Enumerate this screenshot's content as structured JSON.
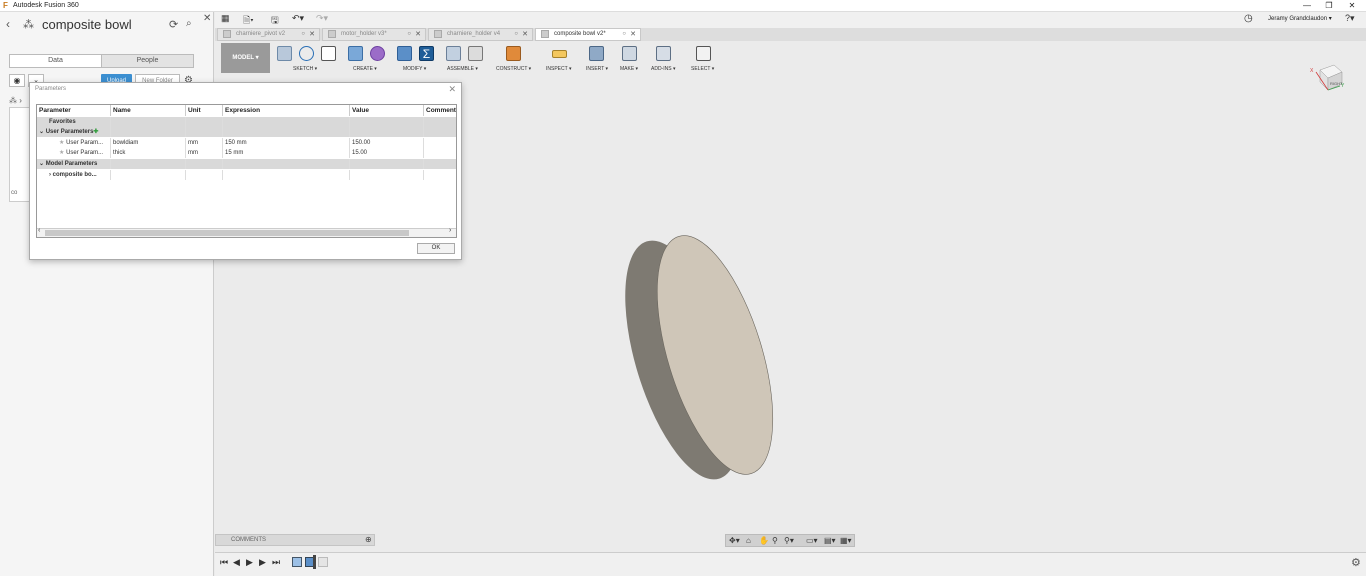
{
  "app": {
    "title": "Autodesk Fusion 360"
  },
  "window": {
    "minimize": "—",
    "restore": "❐",
    "close": "✕"
  },
  "left_panel": {
    "project_title": "composite bowl",
    "tabs": {
      "data": "Data",
      "people": "People"
    },
    "upload_label": "Upload",
    "new_folder_label": "New Folder",
    "card_label": "co"
  },
  "quick_access": {
    "user": "Jeramy Grandclaudon ▾",
    "help": "?▾"
  },
  "tabs": [
    {
      "label": "charniere_pivot v2",
      "status": "○",
      "close": "✕"
    },
    {
      "label": "motor_holder v3*",
      "status": "○",
      "close": "✕"
    },
    {
      "label": "charniere_holder v4",
      "status": "○",
      "close": "✕"
    },
    {
      "label": "composite bowl v2*",
      "status": "○",
      "close": "✕"
    }
  ],
  "ribbon": {
    "workspace": "MODEL ▾",
    "groups": [
      "SKETCH ▾",
      "CREATE ▾",
      "MODIFY ▾",
      "ASSEMBLE ▾",
      "CONSTRUCT ▾",
      "INSPECT ▾",
      "INSERT ▾",
      "MAKE ▾",
      "ADD-INS ▾",
      "SELECT ▾"
    ]
  },
  "dialog": {
    "title": "Parameters",
    "columns": [
      "Parameter",
      "Name",
      "Unit",
      "Expression",
      "Value",
      "Comment"
    ],
    "favorites": "Favorites",
    "user_params_header": "User Parameters",
    "user_params": [
      {
        "parameter": "User Param...",
        "name": "bowldiam",
        "unit": "mm",
        "expression": "150 mm",
        "value": "150.00"
      },
      {
        "parameter": "User Param...",
        "name": "thick",
        "unit": "mm",
        "expression": "15 mm",
        "value": "15.00"
      }
    ],
    "model_params_header": "Model Parameters",
    "model_child": "composite bo...",
    "ok_label": "OK"
  },
  "viewcube": {
    "x": "X",
    "y": "Y",
    "face": "RIGHT"
  },
  "bottom": {
    "comments_label": "COMMENTS"
  },
  "colors": {
    "accent": "#3c8fd1",
    "disk_face": "#cfc6b8",
    "disk_edge": "#7e7a72"
  }
}
